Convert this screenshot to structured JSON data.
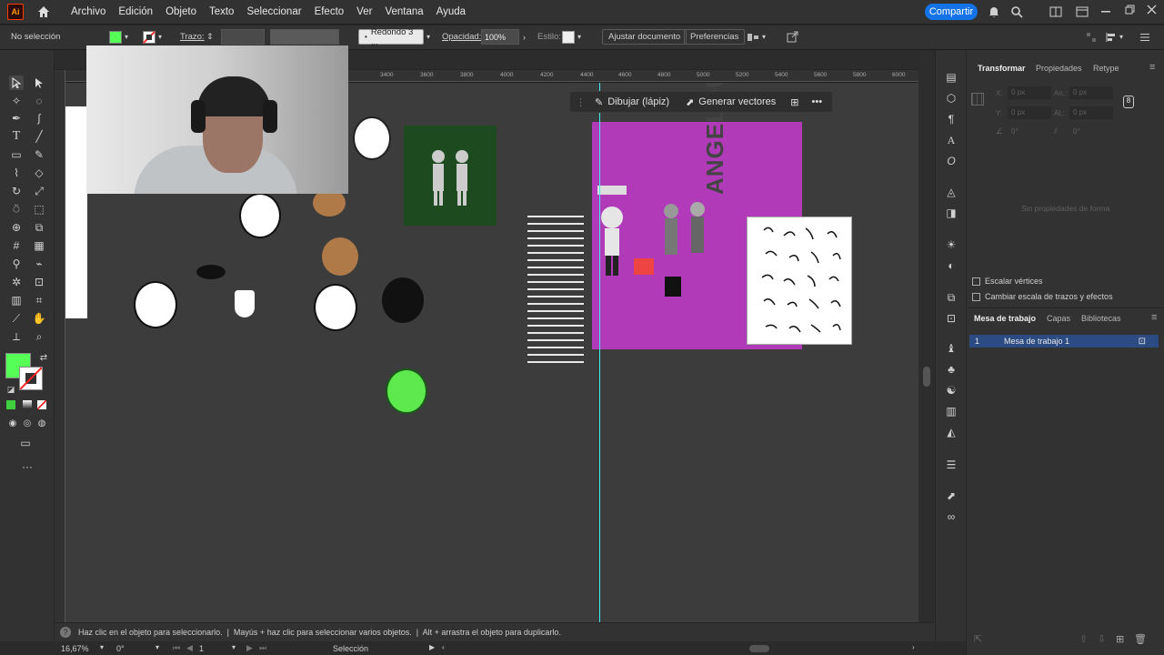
{
  "menu": {
    "app_logo": "Ai",
    "items": [
      "Archivo",
      "Edición",
      "Objeto",
      "Texto",
      "Seleccionar",
      "Efecto",
      "Ver",
      "Ventana",
      "Ayuda"
    ],
    "share_label": "Compartir"
  },
  "control_bar": {
    "selection": "No selección",
    "stroke_label": "Trazo:",
    "brush_label": "Redondo 3 ...",
    "opacity_label": "Opacidad:",
    "opacity_value": "100%",
    "style_label": "Estilo:",
    "fit_doc_button": "Ajustar documento",
    "prefs_button": "Preferencias",
    "fill_color": "#55ff55",
    "stroke_color": "#ff3333"
  },
  "ruler": {
    "ticks": [
      "3400",
      "3600",
      "3800",
      "4000",
      "4200",
      "4400",
      "4600",
      "4800",
      "5000",
      "5200",
      "5400",
      "5600",
      "5800",
      "6000"
    ]
  },
  "context_bar": {
    "draw_label": "Dibujar (lápiz)",
    "vectors_label": "Generar vectores"
  },
  "artboard": {
    "vertical_text": "ANGELOUSKI"
  },
  "right_panel": {
    "tabs": [
      "Transformar",
      "Propiedades",
      "Retype"
    ],
    "x_label": "X:",
    "y_label": "Y:",
    "w_label": "An.:",
    "h_label": "Al.:",
    "x_value": "0 px",
    "y_value": "0 px",
    "w_value": "0 px",
    "h_value": "0 px",
    "angle_value": "0°",
    "shear_value": "0°",
    "no_shape_text": "Sin propiedades de forma",
    "scale_corners": "Escalar vértices",
    "scale_strokes": "Cambiar escala de trazos y efectos",
    "tabs2": [
      "Mesa de trabajo",
      "Capas",
      "Bibliotecas"
    ],
    "artboard_number": "1",
    "artboard_name": "Mesa de trabajo 1"
  },
  "status": {
    "hint": "Haz clic en el objeto para seleccionarlo.  |  Mayús + haz clic para seleccionar varios objetos.  |  Alt + arrastra el objeto para duplicarlo.",
    "zoom": "16,67%",
    "rotation": "0°",
    "artboard_nav": "1",
    "mode": "Selección"
  },
  "colors": {
    "accent": "#1473e6",
    "artboard_magenta": "#b13ab8",
    "green_art": "#1d4a1f",
    "face_green": "#5eea4f",
    "face_tan": "#b07a48"
  }
}
